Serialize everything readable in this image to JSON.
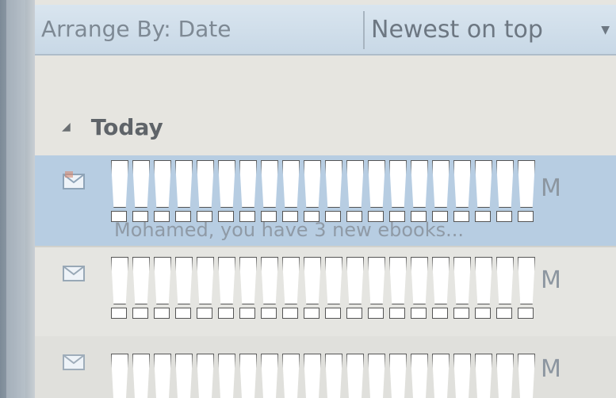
{
  "toolbar": {
    "arrange_by": "Arrange By: Date",
    "sort_order": "Newest on top",
    "dropdown_glyph": "▼"
  },
  "group": {
    "toggle_glyph": "◢",
    "title": "Today"
  },
  "messages": [
    {
      "time": "M",
      "preview": "Mohamed, you have 3 new ebooks...",
      "selected": true,
      "icon": "envelope-icon"
    },
    {
      "time": "M",
      "preview": "",
      "selected": false,
      "icon": "envelope-icon"
    },
    {
      "time": "M",
      "preview": "",
      "selected": false,
      "icon": "envelope-icon"
    }
  ],
  "overlay": {
    "mark_glyph": "!",
    "mark_count": 20
  },
  "colors": {
    "toolbar_bg": "#cddbe8",
    "selected_row": "#b7cde2",
    "list_bg": "#e6e5e0",
    "text_muted": "#7e8994"
  }
}
